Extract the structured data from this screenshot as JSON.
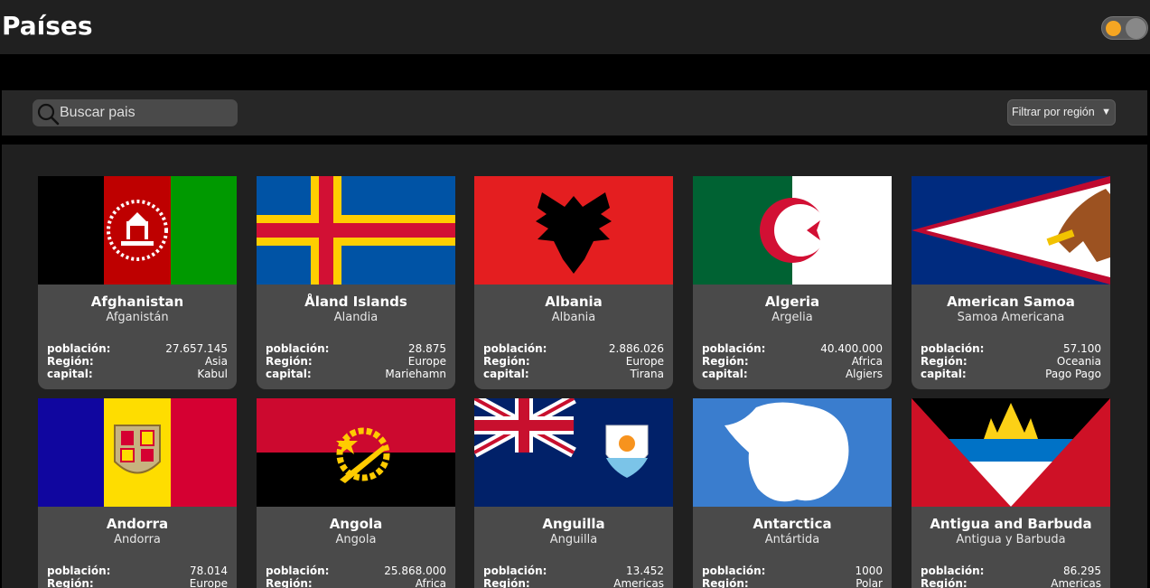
{
  "header": {
    "title": "Países",
    "theme_toggle": "theme-toggle"
  },
  "search": {
    "placeholder": "Buscar pais",
    "value": ""
  },
  "filter": {
    "label": "Filtrar por región"
  },
  "labels": {
    "population": "población:",
    "region": "Región:",
    "capital": "capital:"
  },
  "countries": [
    {
      "name": "Afghanistan",
      "name_es": "Afganistán",
      "population": "27.657.145",
      "region": "Asia",
      "capital": "Kabul"
    },
    {
      "name": "Åland Islands",
      "name_es": "Alandia",
      "population": "28.875",
      "region": "Europe",
      "capital": "Mariehamn"
    },
    {
      "name": "Albania",
      "name_es": "Albania",
      "population": "2.886.026",
      "region": "Europe",
      "capital": "Tirana"
    },
    {
      "name": "Algeria",
      "name_es": "Argelia",
      "population": "40.400.000",
      "region": "Africa",
      "capital": "Algiers"
    },
    {
      "name": "American Samoa",
      "name_es": "Samoa Americana",
      "population": "57.100",
      "region": "Oceania",
      "capital": "Pago Pago"
    },
    {
      "name": "Andorra",
      "name_es": "Andorra",
      "population": "78.014",
      "region": "Europe",
      "capital": ""
    },
    {
      "name": "Angola",
      "name_es": "Angola",
      "population": "25.868.000",
      "region": "Africa",
      "capital": ""
    },
    {
      "name": "Anguilla",
      "name_es": "Anguilla",
      "population": "13.452",
      "region": "Americas",
      "capital": ""
    },
    {
      "name": "Antarctica",
      "name_es": "Antártida",
      "population": "1000",
      "region": "Polar",
      "capital": ""
    },
    {
      "name": "Antigua and Barbuda",
      "name_es": "Antigua y Barbuda",
      "population": "86.295",
      "region": "Americas",
      "capital": ""
    }
  ],
  "colors": {
    "accent": "#f5a623",
    "background": "#202020",
    "card": "#4a4a4a"
  }
}
